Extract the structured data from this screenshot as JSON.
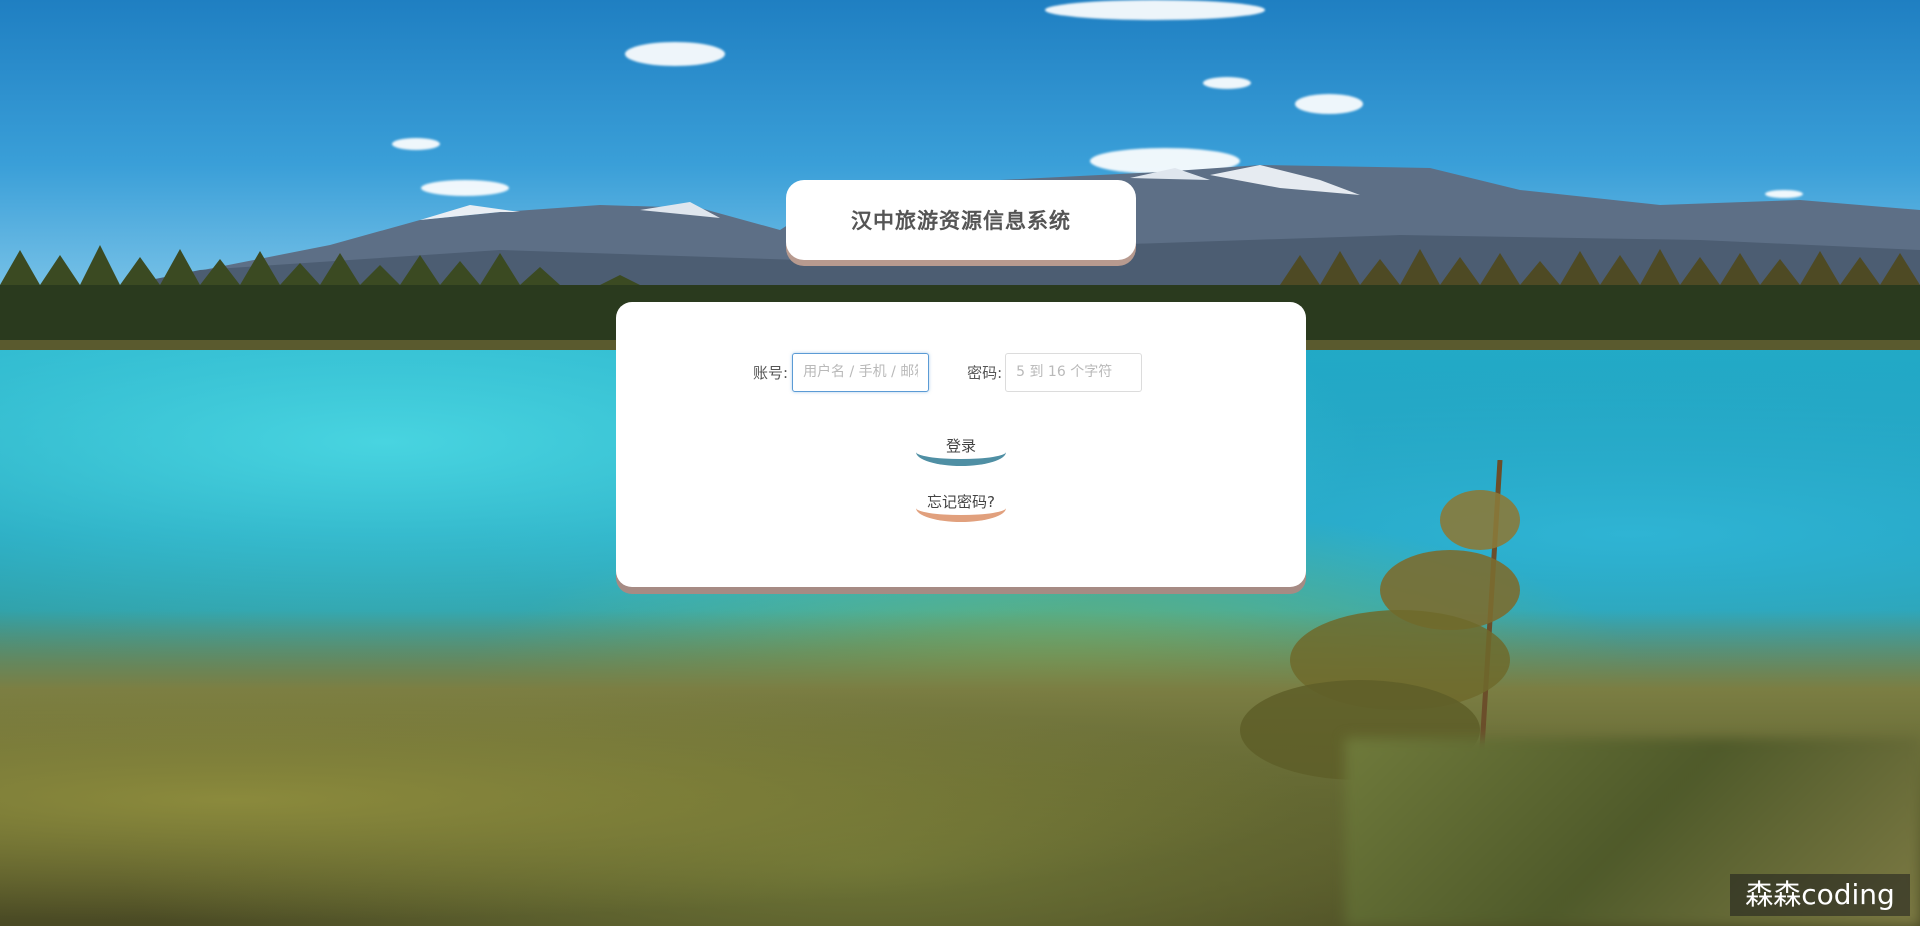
{
  "app": {
    "title": "汉中旅游资源信息系统"
  },
  "login_form": {
    "account_label": "账号:",
    "account_placeholder": "用户名 / 手机 / 邮箱",
    "account_value": "",
    "password_label": "密码:",
    "password_placeholder": "5 到 16 个字符",
    "password_value": "",
    "login_button": "登录",
    "forgot_button": "忘记密码?"
  },
  "watermark": {
    "text": "森森coding"
  },
  "colors": {
    "panel_background": "#ffffff",
    "title_shadow": "#b79a8f",
    "panel_shadow": "#a68b84",
    "login_accent": "#4f8fa4",
    "forgot_accent": "#e1a07d",
    "focused_input_border": "#5b9bd5"
  },
  "icons": {
    "cursor": "text-cursor-icon"
  }
}
